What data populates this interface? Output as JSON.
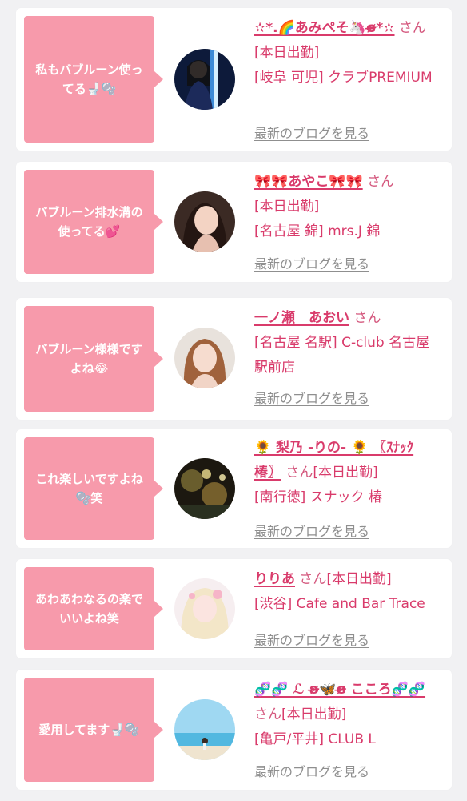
{
  "blog_link_label": "最新のブログを見る",
  "accent_pink": "#f79aab",
  "name_color": "#d93b6b",
  "cards": [
    {
      "comment": "私もバブルーン使ってる🚽🫧",
      "name": "✫*.🌈あみぺそ🦄ɞ̴̶̷*✫",
      "san": "さん",
      "status": "[本日出勤]",
      "shop": "[岐阜 可児] クラブPREMIUM"
    },
    {
      "comment": "バブルーン排水溝の使ってる💕",
      "name": "🎀🎀あやこ🎀🎀",
      "san": "さん",
      "status": "[本日出勤]",
      "shop": "[名古屋 錦] mrs.J 錦"
    },
    {
      "comment": "バブルーン様様ですよね😂",
      "name": "一ノ瀬　あおい",
      "san": "さん",
      "status": "",
      "shop": "[名古屋 名駅] C-club 名古屋駅前店"
    },
    {
      "comment": "これ楽しいですよね🫧笑",
      "name": "🌻 梨乃 -りの- 🌻 〖ｽﾅｯｸ椿〗",
      "san": "さん",
      "status": "[本日出勤]",
      "shop": "[南行徳] スナック 椿"
    },
    {
      "comment": "あわあわなるの楽でいいよね笑",
      "name": "りりあ",
      "san": "さん",
      "status": "[本日出勤]",
      "shop": "[渋谷] Cafe and Bar Trace"
    },
    {
      "comment": "愛用してます🚽🫧",
      "name": "🧬🧬 ℒ ʚ̴̶̷🦋ɞ̴̶̷ こころ🧬🧬",
      "san": "さん",
      "status": "[本日出勤]",
      "shop": "[亀戸/平井] CLUB L"
    }
  ]
}
